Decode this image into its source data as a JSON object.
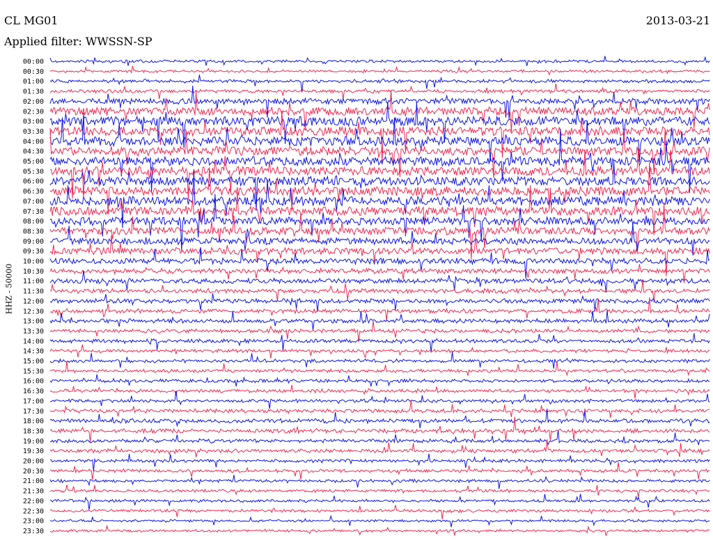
{
  "header": {
    "station": "CL MG01",
    "date": "2013-03-21",
    "filter_text": "Applied filter: WWSSN-SP",
    "channel_label": "HHZ - 50000"
  },
  "colors": {
    "trace_a": "#0a14e6",
    "trace_b": "#f0284f",
    "background": "#ffffff",
    "label_text": "#000000"
  },
  "chart_data": {
    "type": "line",
    "description_type": "helicorder",
    "title": "CL MG01",
    "date": "2013-03-21",
    "filter": "WWSSN-SP",
    "ylabel": "HHZ - 50000",
    "row_labels": [
      "00:00",
      "00:30",
      "01:00",
      "01:30",
      "02:00",
      "02:30",
      "03:00",
      "03:30",
      "04:00",
      "04:30",
      "05:00",
      "05:30",
      "06:00",
      "06:30",
      "07:00",
      "07:30",
      "08:00",
      "08:30",
      "09:00",
      "09:30",
      "10:00",
      "10:30",
      "11:00",
      "11:30",
      "12:00",
      "12:30",
      "13:00",
      "13:30",
      "14:00",
      "14:30",
      "15:00",
      "15:30",
      "16:00",
      "16:30",
      "17:00",
      "17:30",
      "18:00",
      "18:30",
      "19:00",
      "19:30",
      "20:00",
      "20:30",
      "21:00",
      "21:30",
      "22:00",
      "22:30",
      "23:00",
      "23:30"
    ],
    "row_colors": [
      "trace_a",
      "trace_b"
    ],
    "series": [
      {
        "values": [
          0.2,
          0.2,
          0.3,
          0.3,
          0.6,
          0.9,
          1.0,
          1.0,
          1.0,
          1.0,
          1.0,
          1.0,
          1.0,
          1.0,
          1.0,
          1.0,
          0.9,
          0.8,
          0.7,
          0.7,
          0.6,
          0.5,
          0.5,
          0.45,
          0.45,
          0.4,
          0.4,
          0.35,
          0.35,
          0.3,
          0.3,
          0.3,
          0.3,
          0.3,
          0.3,
          0.35,
          0.4,
          0.4,
          0.35,
          0.35,
          0.3,
          0.3,
          0.25,
          0.25,
          0.25,
          0.25,
          0.2,
          0.2
        ]
      }
    ],
    "legend": "none",
    "grid": false
  }
}
